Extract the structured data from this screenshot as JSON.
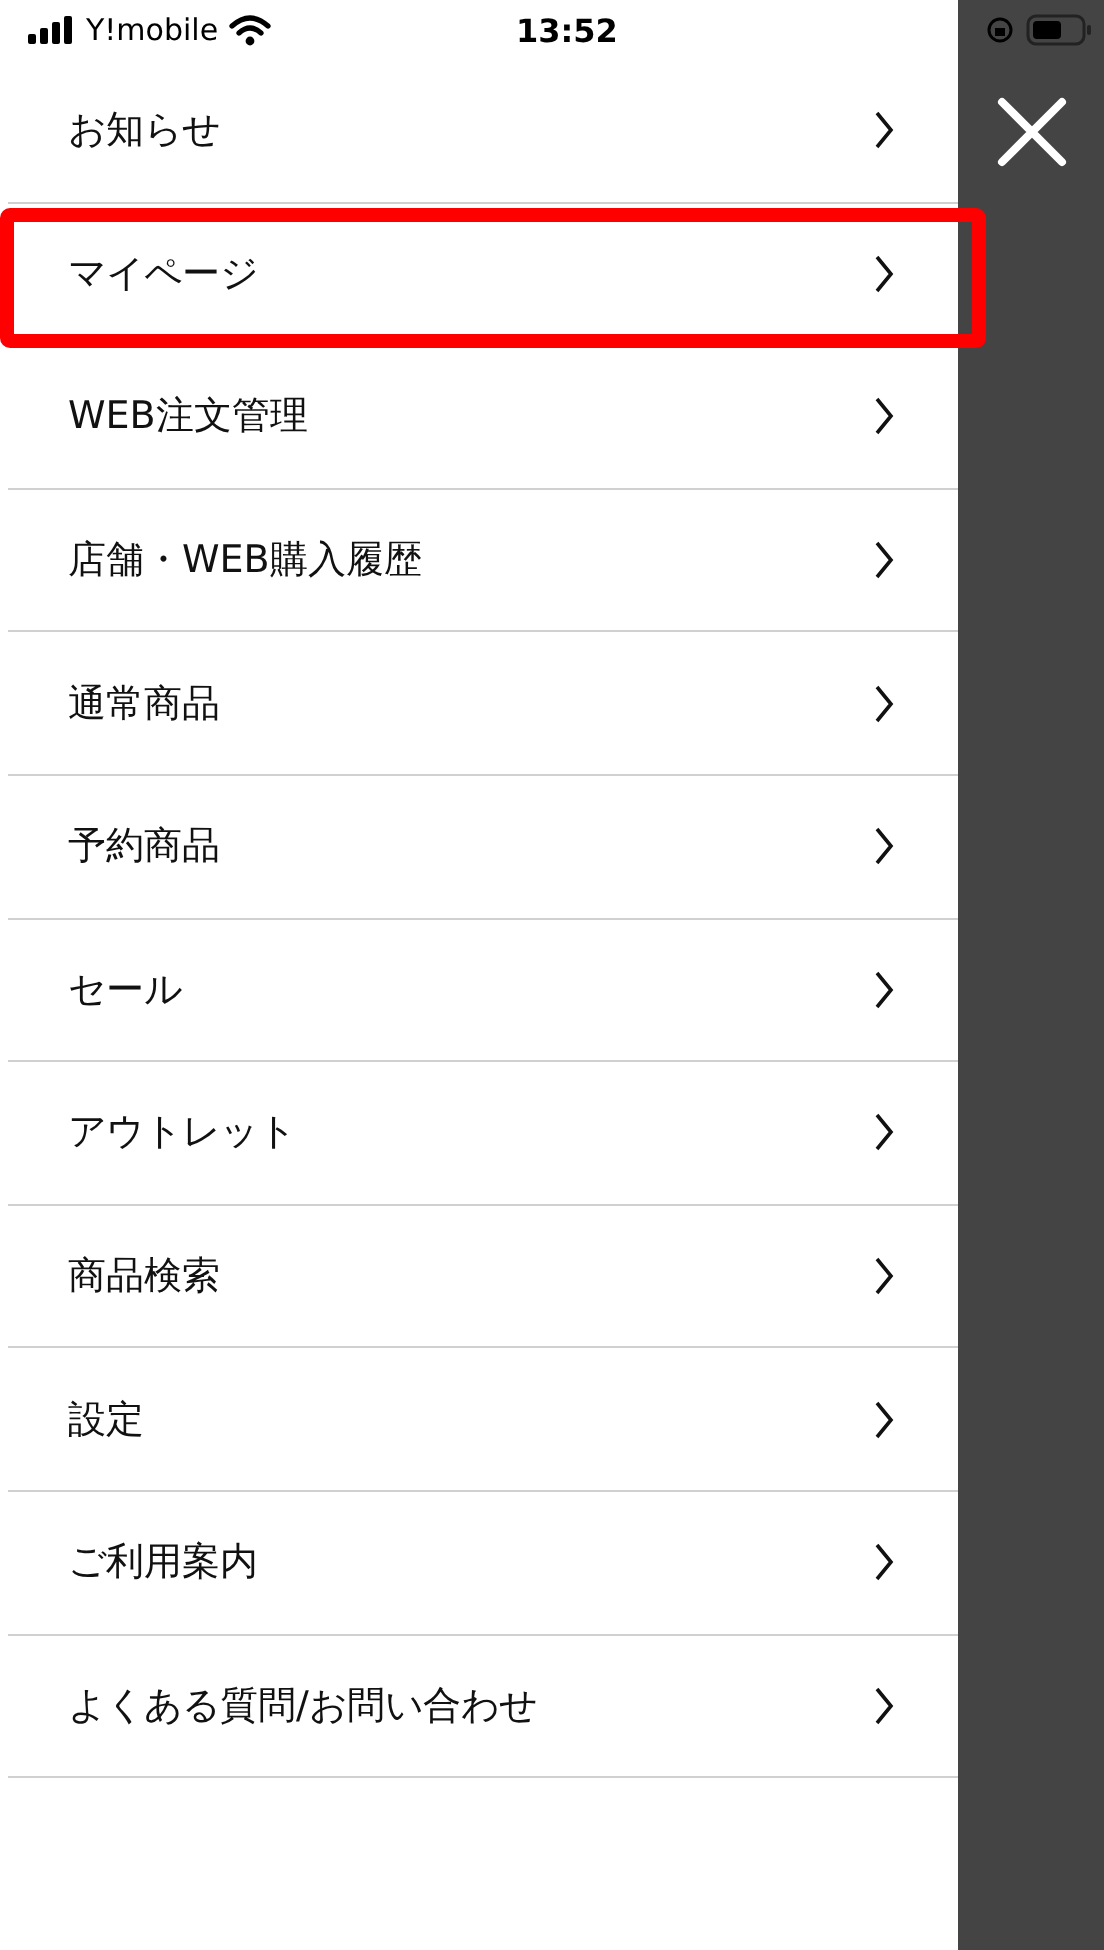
{
  "status_bar": {
    "carrier": "Y!mobile",
    "time": "13:52"
  },
  "menu": {
    "items": [
      {
        "label": "お知らせ",
        "highlighted": false
      },
      {
        "label": "マイページ",
        "highlighted": true
      },
      {
        "label": "WEB注文管理",
        "highlighted": false
      },
      {
        "label": "店舗・WEB購入履歴",
        "highlighted": false
      },
      {
        "label": "通常商品",
        "highlighted": false
      },
      {
        "label": "予約商品",
        "highlighted": false
      },
      {
        "label": "セール",
        "highlighted": false
      },
      {
        "label": "アウトレット",
        "highlighted": false
      },
      {
        "label": "商品検索",
        "highlighted": false
      },
      {
        "label": "設定",
        "highlighted": false
      },
      {
        "label": "ご利用案内",
        "highlighted": false
      },
      {
        "label": "よくある質問/お問い合わせ",
        "highlighted": false
      }
    ]
  }
}
